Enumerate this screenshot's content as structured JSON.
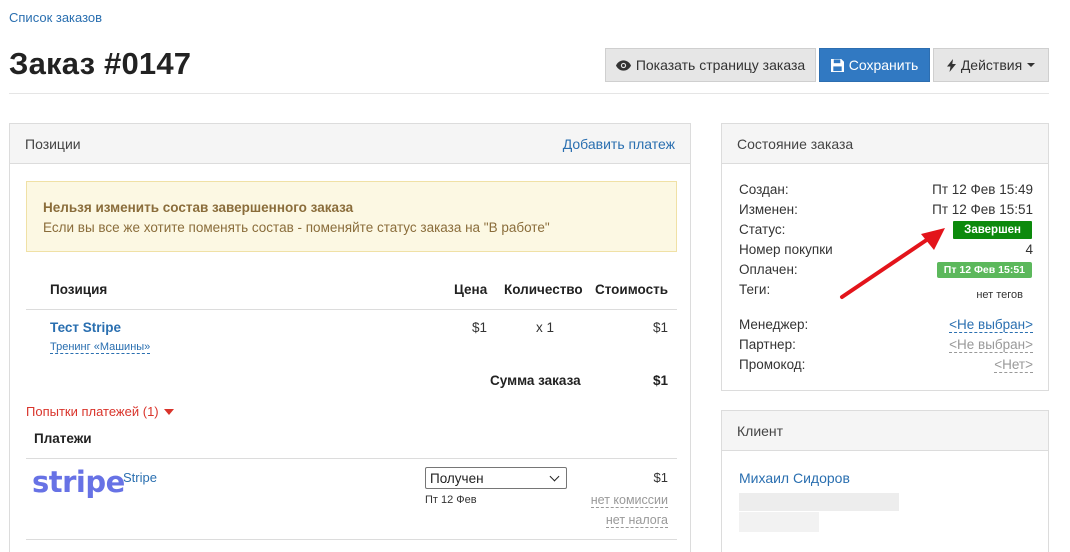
{
  "breadcrumb": "Список заказов",
  "title": "Заказ #0147",
  "buttons": {
    "show_order_page": "Показать страницу заказа",
    "save": "Сохранить",
    "actions": "Действия"
  },
  "positions_panel": {
    "title": "Позиции",
    "add_payment": "Добавить платеж",
    "alert_title": "Нельзя изменить состав завершенного заказа",
    "alert_text": "Если вы все же хотите поменять состав - поменяйте статус заказа на \"В работе\"",
    "columns": [
      "Позиция",
      "Цена",
      "Количество",
      "Стоимость"
    ],
    "items": [
      {
        "name": "Тест Stripe",
        "subtitle": "Тренинг «Машины»",
        "price": "$1",
        "qty": "x 1",
        "cost": "$1"
      }
    ],
    "sum_label": "Сумма заказа",
    "sum_value": "$1",
    "attempts": "Попытки платежей (1)",
    "payments_title": "Платежи",
    "payments": [
      {
        "logo": "stripe",
        "name": "Stripe",
        "status": "Получен",
        "date": "Пт 12 Фев",
        "amount": "$1",
        "commission": "нет комиссии",
        "tax": "нет налога"
      }
    ]
  },
  "status_panel": {
    "title": "Состояние заказа",
    "created_label": "Создан:",
    "created_value": "Пт 12 Фев 15:49",
    "changed_label": "Изменен:",
    "changed_value": "Пт 12 Фев 15:51",
    "status_label": "Статус:",
    "status_value": "Завершен",
    "purchase_label": "Номер покупки",
    "purchase_value": "4",
    "paid_label": "Оплачен:",
    "paid_value": "Пт 12 Фев 15:51",
    "tags_label": "Теги:",
    "tags_value": "нет тегов",
    "manager_label": "Менеджер:",
    "manager_value": "<Не выбран>",
    "partner_label": "Партнер:",
    "partner_value": "<Не выбран>",
    "promo_label": "Промокод:",
    "promo_value": "<Нет>"
  },
  "client_panel": {
    "title": "Клиент",
    "name": "Михаил Сидоров"
  },
  "colors": {
    "primary": "#3179c2",
    "link": "#2a6fb0",
    "status_done": "#0c8a0c",
    "paid_badge": "#5cb85c",
    "alert_bg": "#fcf8e3",
    "danger": "#d9342b",
    "stripe": "#6772e5"
  },
  "icons": {
    "show": "eye-icon",
    "save": "floppy-disk-icon",
    "actions": "bolt-icon"
  }
}
